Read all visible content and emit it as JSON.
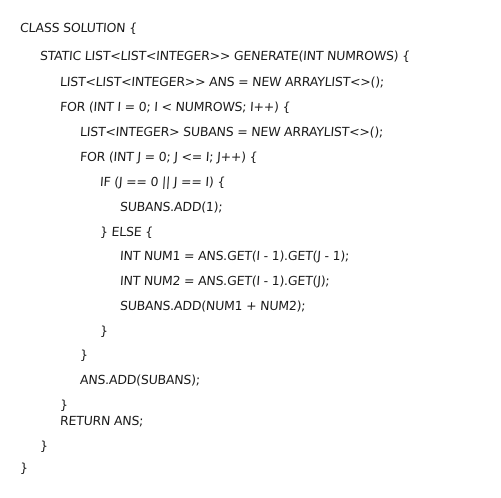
{
  "code": {
    "lines": [
      "CLASS SOLUTION {",
      "STATIC LIST<LIST<INTEGER>> GENERATE(INT NUMROWS) {",
      "LIST<LIST<INTEGER>> ANS = NEW ARRAYLIST<>();",
      "FOR (INT I = 0; I < NUMROWS; I++) {",
      "LIST<INTEGER> SUBANS = NEW ARRAYLIST<>();",
      "FOR (INT J = 0; J <= I; J++) {",
      "IF (J == 0 || J == I) {",
      "SUBANS.ADD(1);",
      "} ELSE {",
      "INT NUM1 = ANS.GET(I - 1).GET(J - 1);",
      "INT NUM2 = ANS.GET(I - 1).GET(J);",
      "SUBANS.ADD(NUM1 + NUM2);",
      "}",
      "}",
      "ANS.ADD(SUBANS);",
      "}",
      "RETURN ANS;",
      "}",
      "}"
    ]
  }
}
